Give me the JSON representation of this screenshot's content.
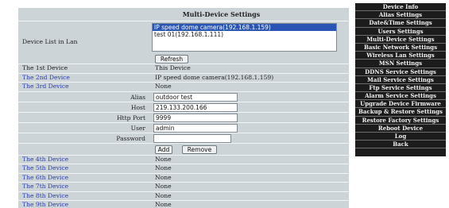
{
  "main": {
    "title": "Multi-Device Settings",
    "lan": {
      "label": "Device List in Lan",
      "items": [
        "IP speed dome camera(192.168.1.159)",
        "test 01(192.168.1.111)"
      ],
      "selected_index": 0,
      "refresh_label": "Refresh"
    },
    "devices_top": [
      {
        "label": "The 1st Device",
        "value": "This Device"
      },
      {
        "label": "The 2nd Device",
        "value": "IP speed dome camera(192.168.1.159)"
      },
      {
        "label": "The 3rd Device",
        "value": "None"
      }
    ],
    "form": {
      "alias_label": "Alias",
      "alias_value": "outdoor test",
      "host_label": "Host",
      "host_value": "219.133.200.166",
      "port_label": "Http Port",
      "port_value": "9999",
      "user_label": "User",
      "user_value": "admin",
      "password_label": "Password",
      "password_value": "",
      "add_label": "Add",
      "remove_label": "Remove"
    },
    "devices_bottom": [
      {
        "label": "The 4th Device",
        "value": "None"
      },
      {
        "label": "The 5th Device",
        "value": "None"
      },
      {
        "label": "The 6th Device",
        "value": "None"
      },
      {
        "label": "The 7th Device",
        "value": "None"
      },
      {
        "label": "The 8th Device",
        "value": "None"
      },
      {
        "label": "The 9th Device",
        "value": "None"
      }
    ]
  },
  "sidebar": {
    "items": [
      "Device Info",
      "Alias Settings",
      "Date&Time Settings",
      "Users Settings",
      "Multi-Device Settings",
      "Basic Network Settings",
      "Wireless Lan Settings",
      "MSN Settings",
      "DDNS Service Settings",
      "Mail Service Settings",
      "Ftp Service Settings",
      "Alarm Service Settings",
      "Upgrade Device Firmware",
      "Backup & Restore Settings",
      "Restore Factory Settings",
      "Reboot Device",
      "Log",
      "Back"
    ]
  },
  "colors": {
    "panel_bg": "#cdd4d8",
    "sidebar_bg": "#1c1c1c",
    "link": "#2b3ea6",
    "selection": "#2a55b5"
  }
}
